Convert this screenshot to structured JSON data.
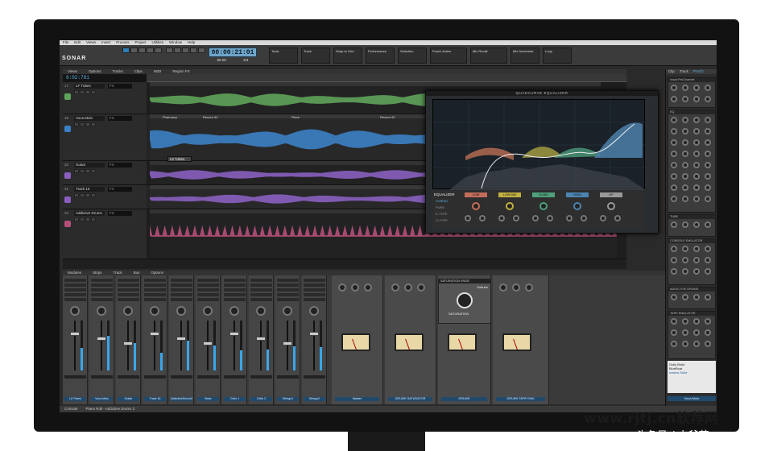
{
  "menu": [
    "File",
    "Edit",
    "Views",
    "Insert",
    "Process",
    "Project",
    "Utilities",
    "Window",
    "Help"
  ],
  "logo": "SONAR",
  "transport": {
    "timecode": "00:00:21:01",
    "tempo": "85.00",
    "meter": "4/4",
    "now_time": "8:02:781"
  },
  "modules": [
    {
      "title": "Tools"
    },
    {
      "title": "Track"
    },
    {
      "title": "Snap to Grid"
    },
    {
      "title": "Performance"
    },
    {
      "title": "Selection"
    },
    {
      "title": "Punch Active"
    },
    {
      "title": "Mix Recall"
    },
    {
      "title": "Mix Screenset"
    },
    {
      "title": "Loop"
    }
  ],
  "track_view_menu": [
    "Views",
    "Options",
    "Tracks",
    "Clips",
    "MIDI",
    "Region FX"
  ],
  "tracks": [
    {
      "num": "17",
      "name": "LF Tubes",
      "fx": "FX",
      "color": "#5fa35a"
    },
    {
      "num": "18",
      "name": "Voca Molo",
      "fx": "FX",
      "color": "#3b7fc4"
    },
    {
      "num": "20",
      "name": "Guitar",
      "fx": "FX",
      "color": "#8a5fc0"
    },
    {
      "num": "21",
      "name": "Track 16",
      "fx": "FX",
      "color": "#8a5fc0"
    },
    {
      "num": "22",
      "name": "Addictive Drums",
      "fx": "FX",
      "color": "#b54f7a"
    }
  ],
  "clip_labels": [
    "Pharmacy",
    "Record 42",
    "Piece",
    "Record 42",
    "Record 2"
  ],
  "popup_label": "Lit Tubes",
  "eq": {
    "title": "QUADCURVE EQUALIZER",
    "section": "EQUALIZER",
    "modes": [
      "HYBRID",
      "PURE",
      "E-TYPE",
      "G-TYPE"
    ],
    "bands": [
      "LOW",
      "LOW MID",
      "HI MID",
      "HIGH",
      "HP"
    ]
  },
  "console_menu": [
    "Modules",
    "Strips",
    "Track",
    "Bus",
    "Options"
  ],
  "strips": [
    {
      "name": "Lit Tubes",
      "meter": 0.45
    },
    {
      "name": "Voca Molo",
      "meter": 0.7
    },
    {
      "name": "Guitar",
      "meter": 0.55
    },
    {
      "name": "Track 16",
      "meter": 0.35
    },
    {
      "name": "AddictiveDrums2",
      "meter": 0.6
    },
    {
      "name": "Bass",
      "meter": 0.5
    },
    {
      "name": "Cello 1",
      "meter": 0.4
    },
    {
      "name": "Cello 2",
      "meter": 0.42
    },
    {
      "name": "Strings1",
      "meter": 0.48
    },
    {
      "name": "Strings2",
      "meter": 0.46
    }
  ],
  "big_strips": [
    {
      "name": "Master"
    },
    {
      "name": "DRUMS SATURATOR"
    },
    {
      "name": "DRUMS"
    },
    {
      "name": "DRUMS TAPE EMU"
    }
  ],
  "saturation_plugin": {
    "title": "SATURATION KNOB",
    "brand": "Softube",
    "label": "SATURATION"
  },
  "browser": {
    "tabs": [
      "Clip",
      "Track",
      "ProCh"
    ],
    "panels": [
      "Vocal ProChannel",
      "EQ",
      "TUBE",
      "CONSOLE EMULATOR",
      "ADDICTIVE DRUMS",
      "TAPE EMULATOR"
    ],
    "plugin": "Gully Build",
    "plugin2": "BlueBoat",
    "brand": "mastra Suite",
    "strip_name": "Voca Molo"
  },
  "bottom_tabs": [
    "Console",
    "Piano Roll - Addictive Drums 2"
  ],
  "watermark": {
    "site": "www.rjtj.cn软荐网",
    "author": "头条号 / 小爷范"
  }
}
